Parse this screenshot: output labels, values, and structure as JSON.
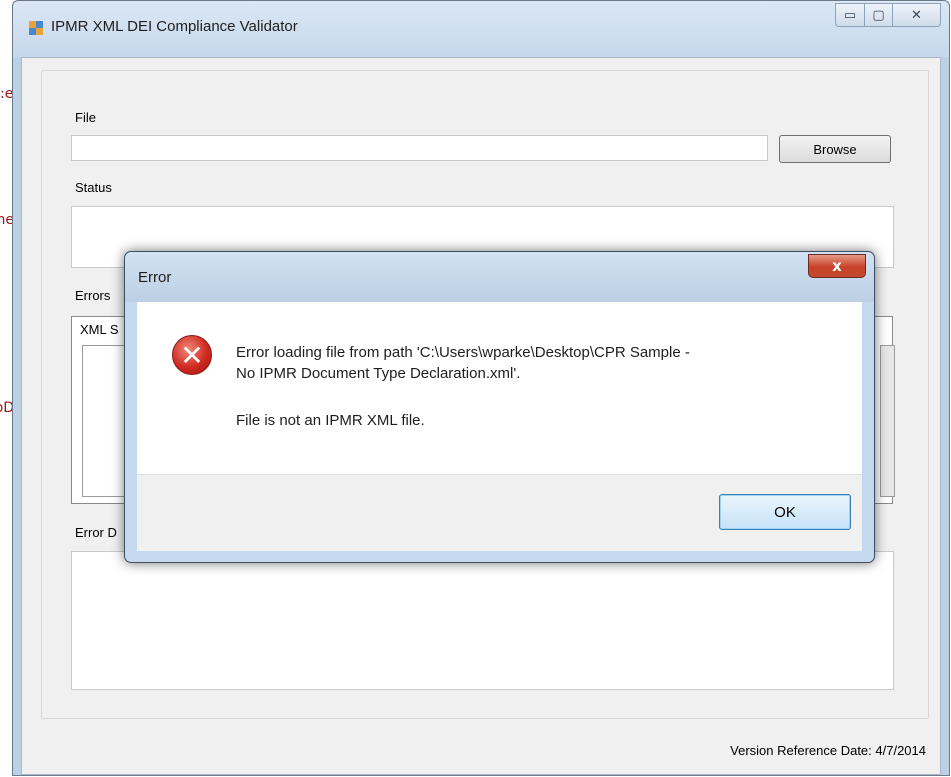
{
  "background_fragments": [
    "e:",
    "me",
    "bD"
  ],
  "main_window": {
    "title": "IPMR XML DEI Compliance Validator",
    "controls": {
      "minimize": "▭",
      "maximize": "▢",
      "close": "✕"
    },
    "file_label": "File",
    "file_value": "",
    "browse_label": "Browse",
    "status_label": "Status",
    "status_value": "",
    "errors_label": "Errors",
    "tab_label": "XML S",
    "error_details_label": "Error D",
    "version_text": "Version Reference Date: 4/7/2014"
  },
  "dialog": {
    "title": "Error",
    "close_glyph": "x",
    "message_line1": "Error loading file from path 'C:\\Users\\wparke\\Desktop\\CPR Sample -",
    "message_line2": "No IPMR Document Type Declaration.xml'.",
    "detail": "File is not an IPMR XML file.",
    "ok_label": "OK",
    "icon_glyph": "✕"
  }
}
